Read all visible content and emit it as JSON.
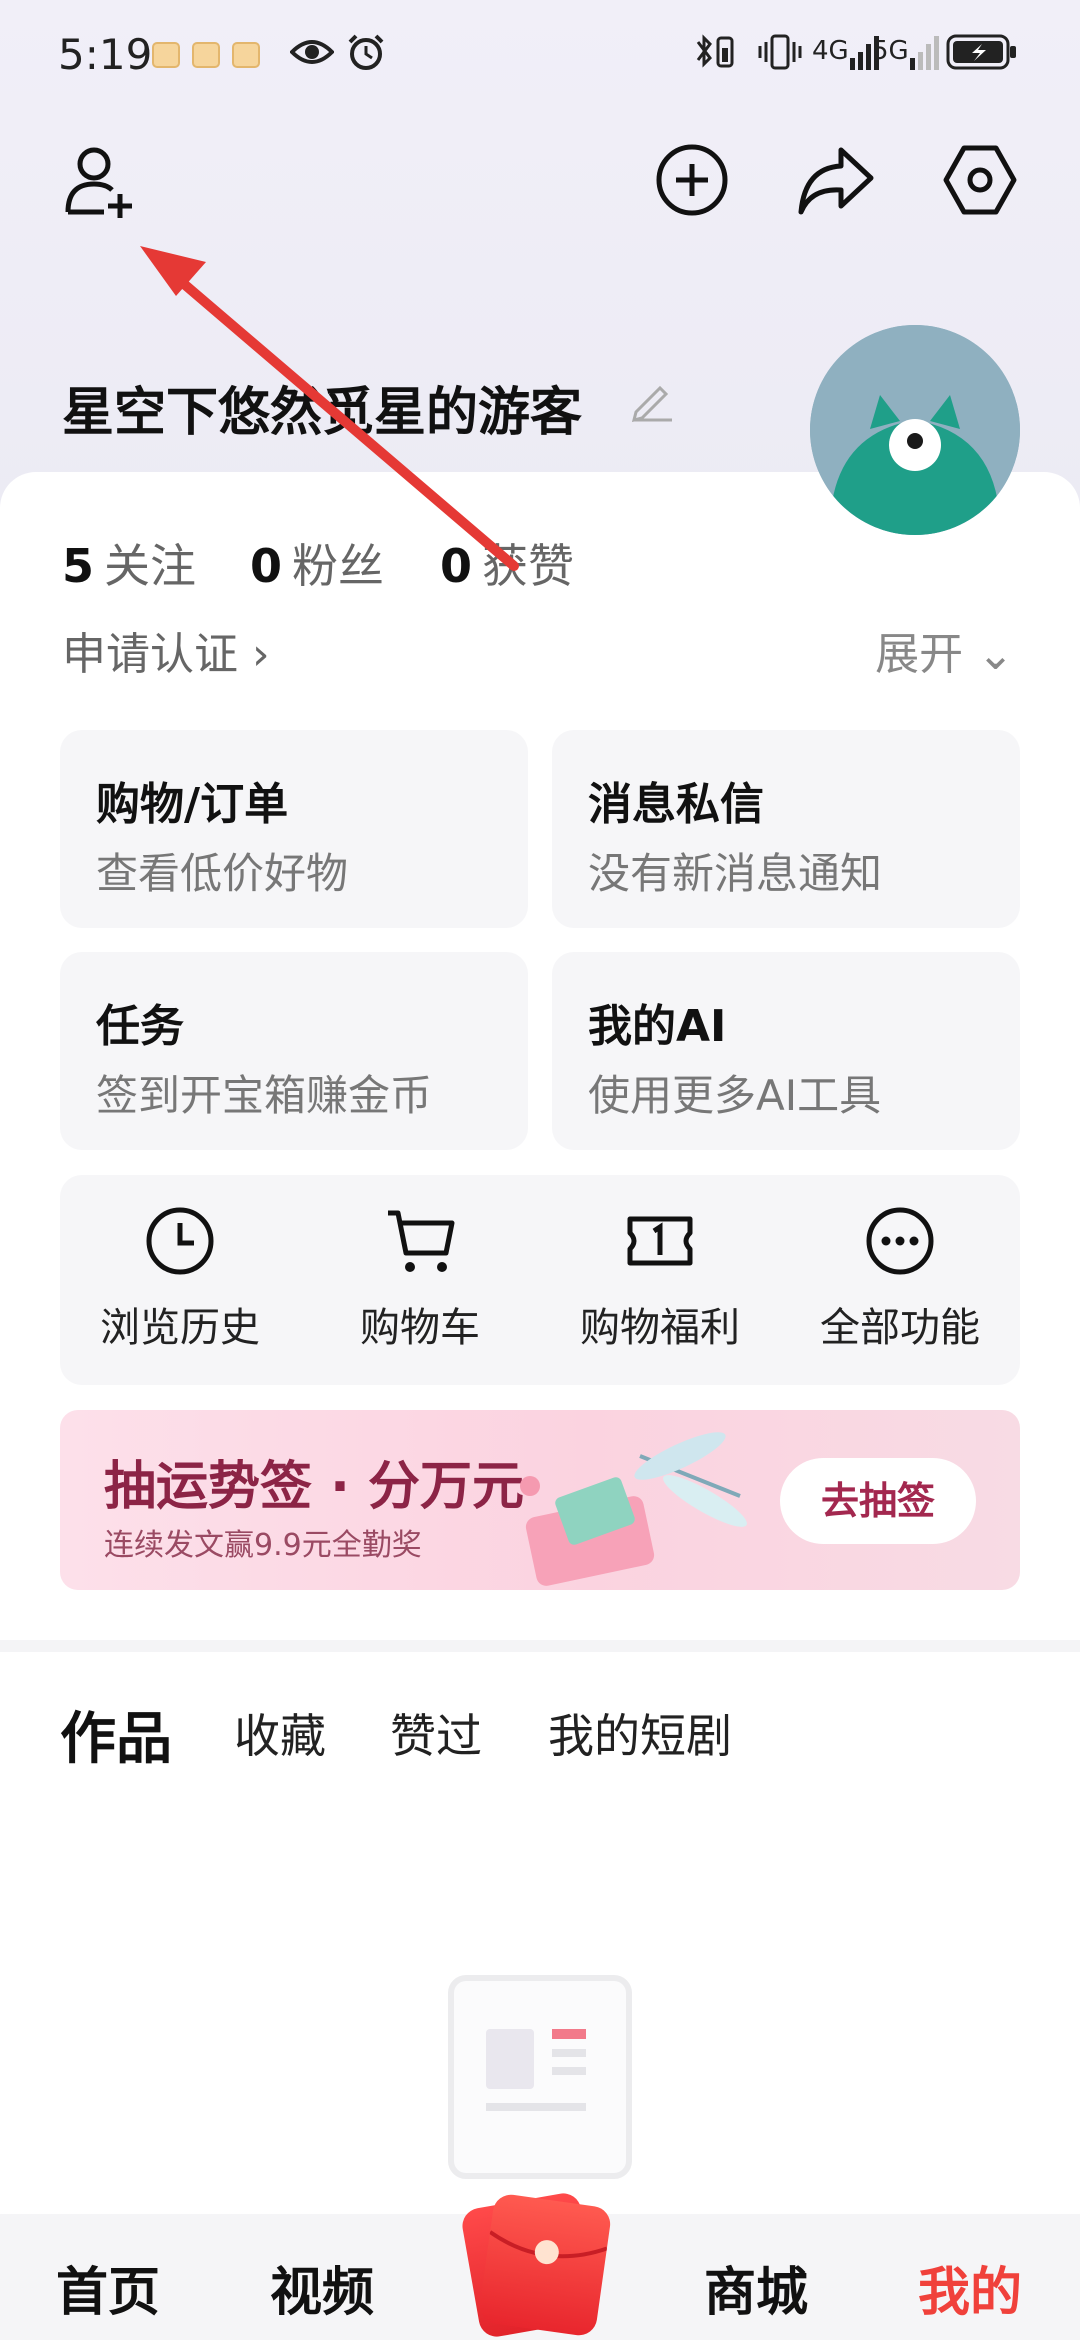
{
  "status_bar": {
    "time": "5:19",
    "network1": "4G",
    "network2": "5G"
  },
  "header": {
    "add_friend_icon": "add-friend-icon",
    "create_icon": "plus-circle-icon",
    "share_icon": "share-icon",
    "settings_icon": "hexagon-settings-icon"
  },
  "profile": {
    "username": "星空下悠然觅星的游客",
    "stats": [
      {
        "num": "5",
        "label": "关注"
      },
      {
        "num": "0",
        "label": "粉丝"
      },
      {
        "num": "0",
        "label": "获赞"
      }
    ],
    "verify": "申请认证 ›",
    "expand": "展开 ⌄"
  },
  "tiles": [
    {
      "title": "购物/订单",
      "subtitle": "查看低价好物"
    },
    {
      "title": "消息私信",
      "subtitle": "没有新消息通知"
    },
    {
      "title": "任务",
      "subtitle": "签到开宝箱赚金币"
    },
    {
      "title": "我的AI",
      "subtitle": "使用更多AI工具"
    }
  ],
  "quick": [
    {
      "label": "浏览历史",
      "icon": "clock-icon"
    },
    {
      "label": "购物车",
      "icon": "cart-icon"
    },
    {
      "label": "购物福利",
      "icon": "coupon-icon"
    },
    {
      "label": "全部功能",
      "icon": "more-icon"
    }
  ],
  "banner": {
    "title": "抽运势签 · 分万元",
    "subtitle": "连续发文赢9.9元全勤奖",
    "button": "去抽签"
  },
  "content_tabs": [
    "作品",
    "收藏",
    "赞过",
    "我的短剧"
  ],
  "bottom_nav": [
    "首页",
    "视频",
    "商城",
    "我的"
  ],
  "colors": {
    "accent": "#f0413b",
    "banner_text": "#8c2446",
    "annotation_arrow": "#e53935"
  }
}
